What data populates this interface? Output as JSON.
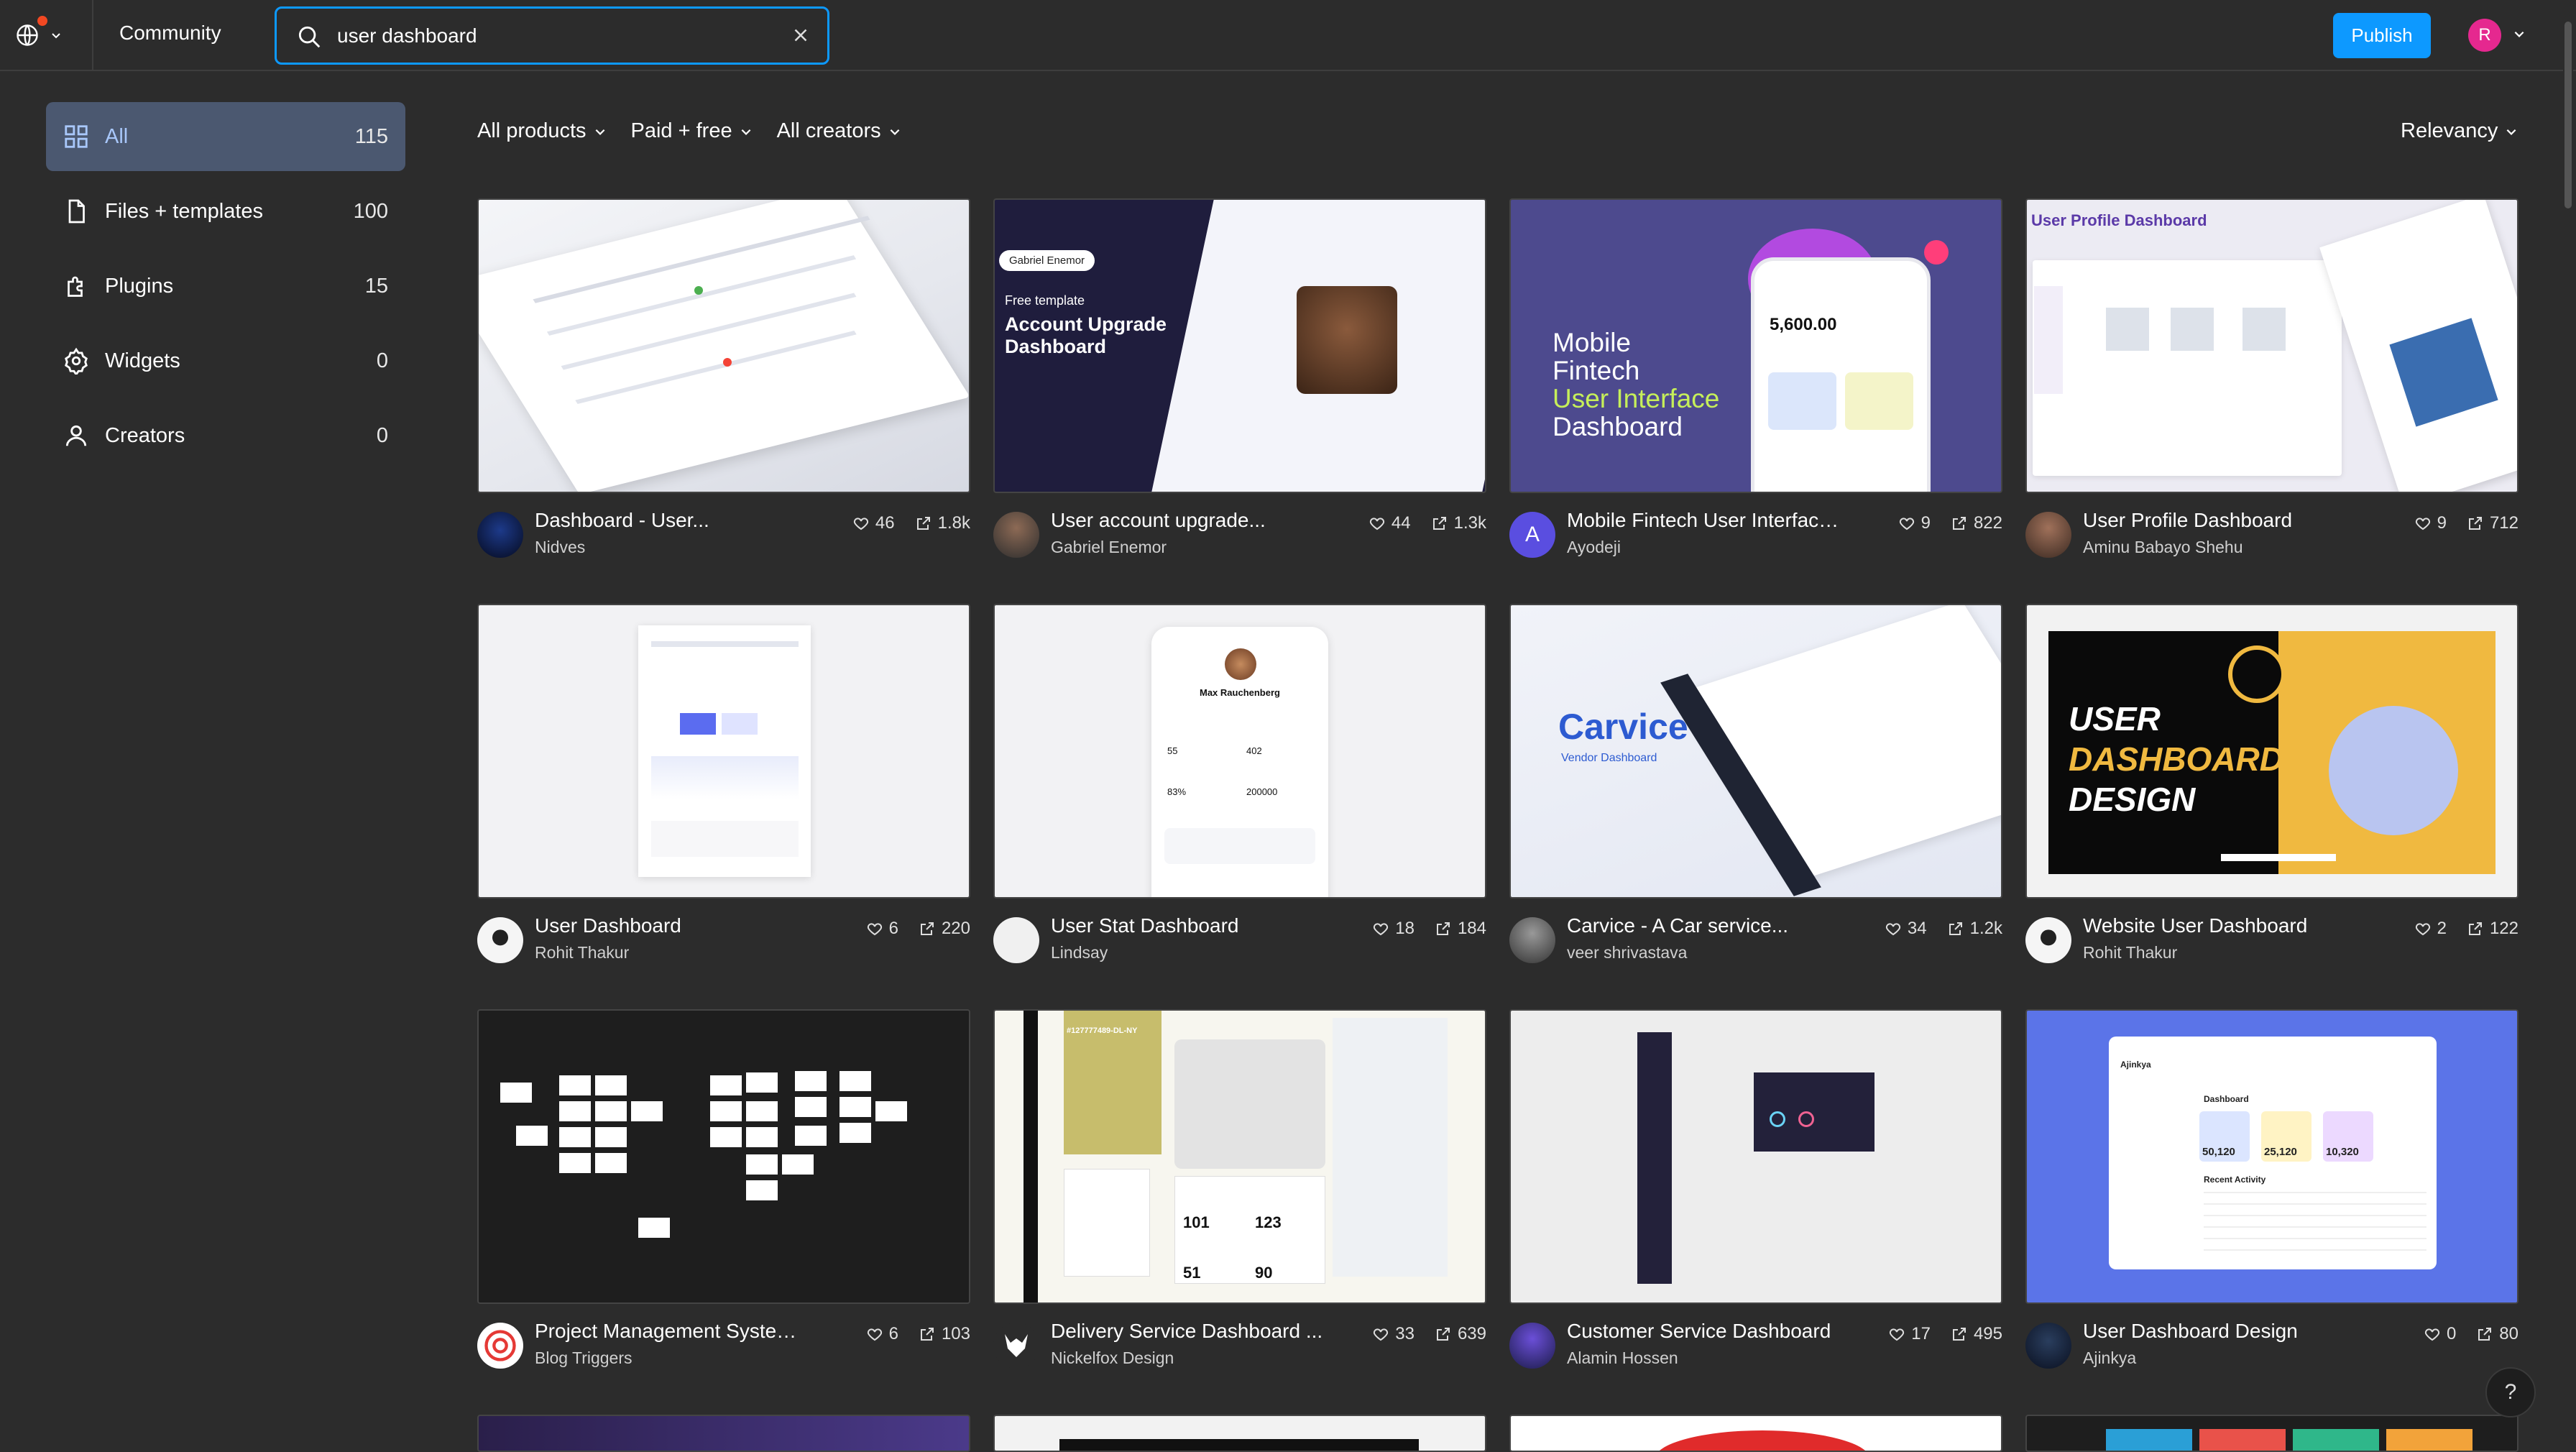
{
  "topbar": {
    "community_label": "Community",
    "search_value": "user dashboard",
    "publish_label": "Publish",
    "user_initial": "R"
  },
  "sidebar": {
    "items": [
      {
        "label": "All",
        "count": "115",
        "icon": "grid-icon",
        "active": true
      },
      {
        "label": "Files + templates",
        "count": "100",
        "icon": "file-icon"
      },
      {
        "label": "Plugins",
        "count": "15",
        "icon": "plugin-icon"
      },
      {
        "label": "Widgets",
        "count": "0",
        "icon": "widget-icon"
      },
      {
        "label": "Creators",
        "count": "0",
        "icon": "user-icon"
      }
    ]
  },
  "filters": {
    "products": "All products",
    "price": "Paid + free",
    "creators": "All creators",
    "sort": "Relevancy"
  },
  "colors": {
    "accent": "#0d99ff",
    "active_nav_bg": "#4b5870",
    "background": "#2c2c2c"
  },
  "cards": [
    {
      "title": "Dashboard - User...",
      "author": "Nidves",
      "likes": "46",
      "uses": "1.8k"
    },
    {
      "title": "User account upgrade...",
      "author": "Gabriel Enemor",
      "likes": "44",
      "uses": "1.3k",
      "thumb_text": {
        "badge": "Gabriel Enemor",
        "kicker": "Free template",
        "heading": "Account Upgrade Dashboard"
      }
    },
    {
      "title": "Mobile Fintech User Interface...",
      "author": "Ayodeji",
      "likes": "9",
      "uses": "822",
      "avatar_letter": "A",
      "thumb_text": {
        "line1": "Mobile",
        "line2": "Fintech",
        "line3": "User Interface",
        "line4": "Dashboard",
        "amount": "5,600.00"
      }
    },
    {
      "title": "User Profile Dashboard",
      "author": "Aminu Babayo Shehu",
      "likes": "9",
      "uses": "712",
      "thumb_text": {
        "heading": "User Profile Dashboard"
      }
    },
    {
      "title": "User Dashboard",
      "author": "Rohit Thakur",
      "likes": "6",
      "uses": "220"
    },
    {
      "title": "User Stat Dashboard",
      "author": "Lindsay",
      "likes": "18",
      "uses": "184",
      "thumb_text": {
        "name": "Max Rauchenberg",
        "stat1": "55",
        "stat2": "402",
        "stat3": "83%",
        "stat4": "200000"
      }
    },
    {
      "title": "Carvice - A Car service...",
      "author": "veer shrivastava",
      "likes": "34",
      "uses": "1.2k",
      "thumb_text": {
        "brand": "Carvice",
        "sub": "Vendor Dashboard"
      }
    },
    {
      "title": "Website User Dashboard",
      "author": "Rohit Thakur",
      "likes": "2",
      "uses": "122",
      "thumb_text": {
        "line1": "USER",
        "line2": "DASHBOARD",
        "line3": "DESIGN"
      }
    },
    {
      "title": "Project Management System...",
      "author": "Blog Triggers",
      "likes": "6",
      "uses": "103"
    },
    {
      "title": "Delivery Service Dashboard ...",
      "author": "Nickelfox Design",
      "likes": "33",
      "uses": "639",
      "thumb_text": {
        "code": "#127777489-DL-NY",
        "n1": "101",
        "n2": "123",
        "n3": "51",
        "n4": "90"
      }
    },
    {
      "title": "Customer Service Dashboard",
      "author": "Alamin Hossen",
      "likes": "17",
      "uses": "495"
    },
    {
      "title": "User Dashboard Design",
      "author": "Ajinkya",
      "likes": "0",
      "uses": "80",
      "thumb_text": {
        "brand": "Ajinkya",
        "heading": "Dashboard",
        "v1": "50,120",
        "v2": "25,120",
        "v3": "10,320",
        "section": "Recent Activity"
      }
    }
  ],
  "help_label": "?"
}
